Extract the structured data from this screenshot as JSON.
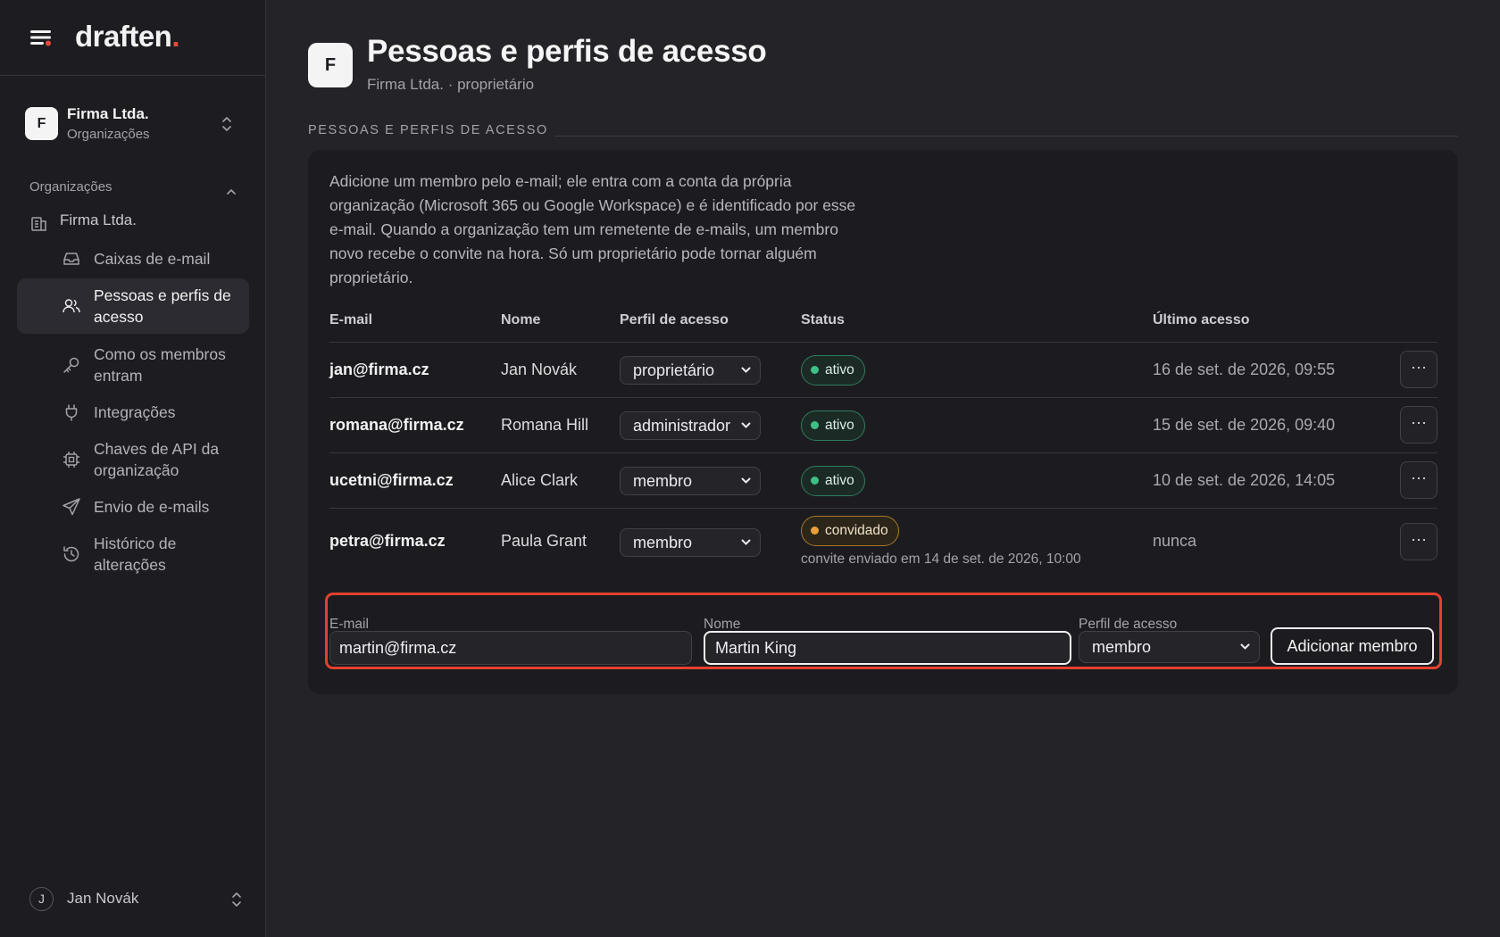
{
  "brand": {
    "name": "draften",
    "dot": "."
  },
  "org_switcher": {
    "initial": "F",
    "name": "Firma Ltda.",
    "subtitle": "Organizações"
  },
  "sidebar": {
    "section_label": "Organizações",
    "org_item": "Firma Ltda.",
    "items": [
      {
        "label": "Caixas de e-mail",
        "icon": "inbox-icon",
        "active": false
      },
      {
        "label": "Pessoas e perfis de acesso",
        "icon": "users-icon",
        "active": true
      },
      {
        "label": "Como os membros entram",
        "icon": "key-icon",
        "active": false
      },
      {
        "label": "Integrações",
        "icon": "plug-icon",
        "active": false
      },
      {
        "label": "Chaves de API da organização",
        "icon": "chip-icon",
        "active": false
      },
      {
        "label": "Envio de e-mails",
        "icon": "send-icon",
        "active": false
      },
      {
        "label": "Histórico de alterações",
        "icon": "history-icon",
        "active": false
      }
    ]
  },
  "user": {
    "initial": "J",
    "name": "Jan Novák"
  },
  "page": {
    "initial": "F",
    "title": "Pessoas e perfis de acesso",
    "subtitle": "Firma Ltda. · proprietário",
    "section_label": "PESSOAS E PERFIS DE ACESSO",
    "intro": "Adicione um membro pelo e-mail; ele entra com a conta da própria organização (Microsoft 365 ou Google Workspace) e é identificado por esse e-mail. Quando a organização tem um remetente de e-mails, um membro novo recebe o convite na hora. Só um proprietário pode tornar alguém proprietário."
  },
  "table": {
    "headers": {
      "email": "E-mail",
      "name": "Nome",
      "role": "Perfil de acesso",
      "status": "Status",
      "last": "Último acesso"
    },
    "rows": [
      {
        "email": "jan@firma.cz",
        "name": "Jan Novák",
        "role": "proprietário",
        "status": "ativo",
        "status_kind": "green",
        "note": "",
        "last": "16 de set. de 2026, 09:55",
        "more": "···"
      },
      {
        "email": "romana@firma.cz",
        "name": "Romana Hill",
        "role": "administrador",
        "status": "ativo",
        "status_kind": "green",
        "note": "",
        "last": "15 de set. de 2026, 09:40",
        "more": "···"
      },
      {
        "email": "ucetni@firma.cz",
        "name": "Alice Clark",
        "role": "membro",
        "status": "ativo",
        "status_kind": "green",
        "note": "",
        "last": "10 de set. de 2026, 14:05",
        "more": "···"
      },
      {
        "email": "petra@firma.cz",
        "name": "Paula Grant",
        "role": "membro",
        "status": "convidado",
        "status_kind": "amber",
        "note": "convite enviado em 14 de set. de 2026, 10:00",
        "last": "nunca",
        "more": "···"
      }
    ]
  },
  "add_form": {
    "email_label": "E-mail",
    "email_value": "martin@firma.cz",
    "name_label": "Nome",
    "name_value": "Martin King",
    "role_label": "Perfil de acesso",
    "role_value": "membro",
    "submit": "Adicionar membro"
  },
  "colors": {
    "accent_red": "#e5402f",
    "active_green": "#3fbf85",
    "invited_amber": "#e5a03c",
    "background": "#232328",
    "sidebar": "#1d1d21"
  }
}
